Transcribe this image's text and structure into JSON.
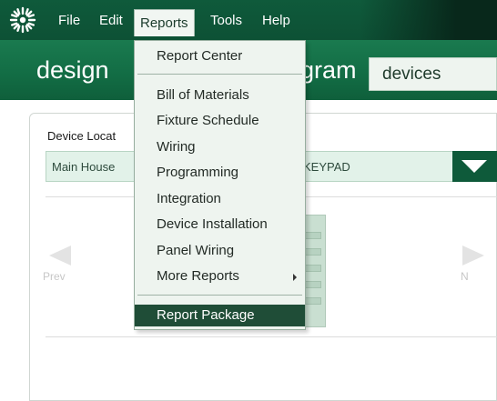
{
  "menubar": {
    "items": [
      {
        "label": "File"
      },
      {
        "label": "Edit"
      },
      {
        "label": "Reports"
      },
      {
        "label": "Tools"
      },
      {
        "label": "Help"
      }
    ],
    "active_item": "Reports"
  },
  "header": {
    "title": "design",
    "title_partial": "gram",
    "view_selector": "devices"
  },
  "location": {
    "label": "Device Locat",
    "path_left": "Main House",
    "path_right": "KEYPAD"
  },
  "navigation": {
    "prev_label": "Prev",
    "next_label": "N"
  },
  "reports_menu": {
    "items": [
      {
        "label": "Report Center"
      },
      {
        "label": "Bill of Materials"
      },
      {
        "label": "Fixture Schedule"
      },
      {
        "label": "Wiring"
      },
      {
        "label": "Programming"
      },
      {
        "label": "Integration"
      },
      {
        "label": "Device Installation"
      },
      {
        "label": "Panel Wiring"
      },
      {
        "label": "More Reports"
      },
      {
        "label": "Report Package"
      }
    ],
    "highlighted": "Report Package"
  },
  "colors": {
    "brand_green": "#0f5a3b",
    "menu_bg": "#eef4ef",
    "highlight": "#1f4d37"
  }
}
